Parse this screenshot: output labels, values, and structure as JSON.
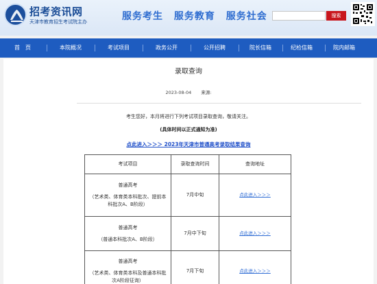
{
  "header": {
    "site_title": "招考资讯网",
    "site_subtitle": "天津市教育招生考试院主办",
    "slogans": [
      "服务考生",
      "服务教育",
      "服务社会"
    ],
    "search_placeholder": "",
    "search_button": "搜索"
  },
  "nav": {
    "items": [
      "首　页",
      "本院概况",
      "考试项目",
      "政务公开",
      "公开招聘",
      "院长信箱",
      "纪检信箱",
      "院内邮箱"
    ]
  },
  "article": {
    "title": "录取查询",
    "date": "2023-08-04",
    "source_label": "来源:",
    "intro": "考生您好，本月将进行下列考试项目录取查询，敬请关注。",
    "note": "(具体时间以正式通知为准)",
    "main_link": "点此进入＞＞＞ 2023年天津市普通高考录取结果查询"
  },
  "table": {
    "headers": [
      "考试项目",
      "录取查询时间",
      "查询地址"
    ],
    "rows": [
      {
        "name": "普通高考",
        "desc": "（艺术类、体育类本科批次、提前本科批次A、B阶段）",
        "time": "7月中旬",
        "link": "点此进入＞＞＞"
      },
      {
        "name": "普通高考",
        "desc": "（普通本科批次A、B阶段）",
        "time": "7月中下旬",
        "link": "点此进入＞＞＞"
      },
      {
        "name": "普通高考",
        "desc": "（艺术类、体育类本科及普通本科批次A阶段征询）",
        "time": "7月下旬",
        "link": "点此进入＞＞＞"
      }
    ]
  },
  "colors": {
    "nav_bg": "#1e5cc0",
    "brand_blue": "#1a4c96",
    "search_red": "#c8161d",
    "link_blue": "#1f4fc9"
  }
}
